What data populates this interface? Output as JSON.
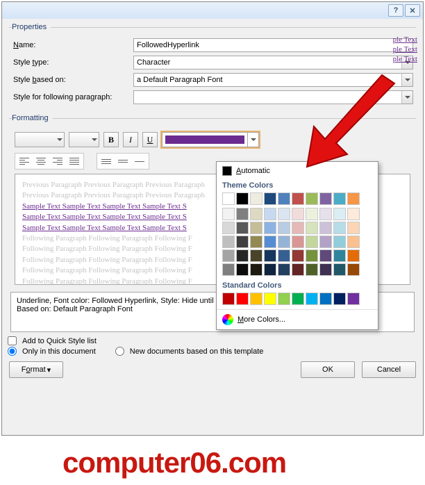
{
  "titlebar": {
    "help": "?",
    "close": "✕"
  },
  "properties": {
    "legend": "Properties",
    "name_label_pre": "",
    "name_key": "N",
    "name_label_post": "ame:",
    "name_value": "FollowedHyperlink",
    "type_label_pre": "Style ",
    "type_key": "t",
    "type_label_post": "ype:",
    "type_value": "Character",
    "based_label_pre": "Style ",
    "based_key": "b",
    "based_label_post": "ased on:",
    "based_value": "a Default Paragraph Font",
    "follow_label": "Style for following paragraph:",
    "follow_value": ""
  },
  "formatting": {
    "legend": "Formatting",
    "font_name": "",
    "font_size": "",
    "bold": "B",
    "italic": "I",
    "underline": "U",
    "color": "#6b2b8f",
    "theme_top": [
      "#ffffff",
      "#000000",
      "#eeece1",
      "#1f497d",
      "#4f81bd",
      "#c0504d",
      "#9bbb59",
      "#8064a2",
      "#4bacc6",
      "#f79646"
    ],
    "theme_tints": [
      [
        "#f2f2f2",
        "#7f7f7f",
        "#ddd9c3",
        "#c6d9f0",
        "#dbe5f1",
        "#f2dcdb",
        "#ebf1dd",
        "#e5e0ec",
        "#dbeef3",
        "#fdeada"
      ],
      [
        "#d8d8d8",
        "#595959",
        "#c4bd97",
        "#8db3e2",
        "#b8cce4",
        "#e5b9b7",
        "#d7e3bc",
        "#ccc1d9",
        "#b7dde8",
        "#fbd5b5"
      ],
      [
        "#bfbfbf",
        "#3f3f3f",
        "#938953",
        "#548dd4",
        "#95b3d7",
        "#d99694",
        "#c3d69b",
        "#b2a2c7",
        "#92cddc",
        "#fac08f"
      ],
      [
        "#a5a5a5",
        "#262626",
        "#494429",
        "#17365d",
        "#366092",
        "#953734",
        "#76923c",
        "#5f497a",
        "#31859b",
        "#e36c09"
      ],
      [
        "#7f7f7f",
        "#0c0c0c",
        "#1d1b10",
        "#0f243e",
        "#244061",
        "#632423",
        "#4f6128",
        "#3f3151",
        "#205867",
        "#974806"
      ]
    ],
    "standard": [
      "#c00000",
      "#ff0000",
      "#ffc000",
      "#ffff00",
      "#92d050",
      "#00b050",
      "#00b0f0",
      "#0070c0",
      "#002060",
      "#7030a0"
    ]
  },
  "picker": {
    "automatic_key": "A",
    "automatic": "utomatic",
    "theme_heading": "Theme Colors",
    "standard_heading": "Standard Colors",
    "more_key": "M",
    "more": "ore Colors..."
  },
  "preview": {
    "gray_text": "Previous Paragraph Previous Paragraph Previous Paragraph",
    "sample_text": "Sample Text Sample Text Sample Text Sample Text S",
    "following_text": "Following Paragraph Following Paragraph Following F",
    "right_sample": "ple Text"
  },
  "description": {
    "line1": "Underline, Font color: Followed Hyperlink, Style: Hide until used",
    "line2": "Based on: Default Paragraph Font"
  },
  "footer": {
    "quick_style": "Add to Quick Style list",
    "only_doc": "Only in this document",
    "new_docs": "New documents based on this template",
    "format_key": "o",
    "format_pre": "F",
    "format_post": "rmat ",
    "ok": "OK",
    "cancel": "Cancel"
  },
  "watermark": "computer06.com"
}
